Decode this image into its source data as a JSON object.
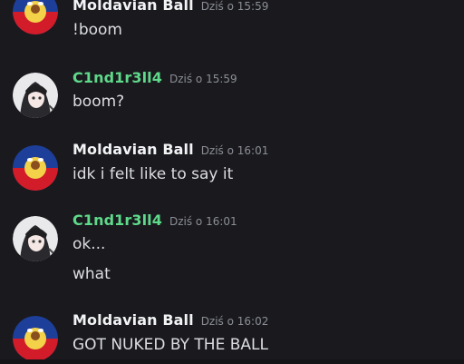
{
  "messages": [
    {
      "author": "Moldavian Ball",
      "author_color": "#f2f3f5",
      "time": "Dziś o 15:59",
      "lines": [
        "!boom"
      ],
      "avatar": "moldova-countryball-avatar"
    },
    {
      "author": "C1nd1r3ll4",
      "author_color": "#5fd98a",
      "time": "Dziś o 15:59",
      "lines": [
        "boom?"
      ],
      "avatar": "anime-girl-avatar"
    },
    {
      "author": "Moldavian Ball",
      "author_color": "#f2f3f5",
      "time": "Dziś o 16:01",
      "lines": [
        "idk i felt like to say it"
      ],
      "avatar": "moldova-countryball-avatar"
    },
    {
      "author": "C1nd1r3ll4",
      "author_color": "#5fd98a",
      "time": "Dziś o 16:01",
      "lines": [
        "ok...",
        "what"
      ],
      "avatar": "anime-girl-avatar"
    },
    {
      "author": "Moldavian Ball",
      "author_color": "#f2f3f5",
      "time": "Dziś o 16:02",
      "lines": [
        "GOT NUKED BY THE BALL"
      ],
      "avatar": "moldova-countryball-avatar"
    }
  ]
}
